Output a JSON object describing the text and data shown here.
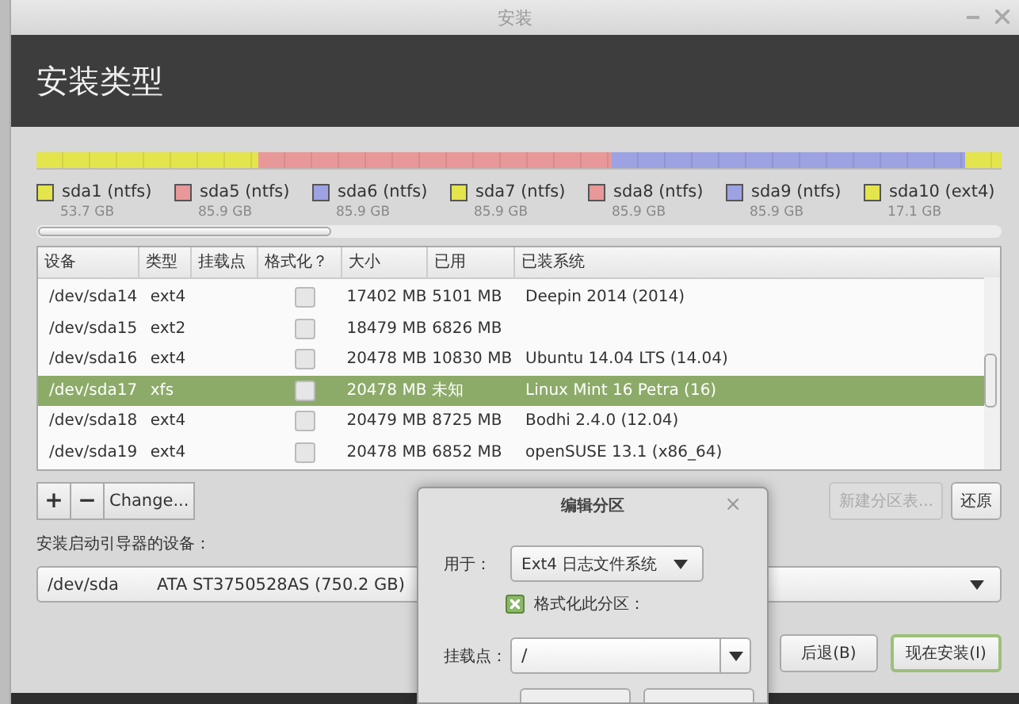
{
  "window": {
    "title": "安装"
  },
  "header": {
    "title": "安装类型"
  },
  "partitions": [
    {
      "name": "sda1 (ntfs)",
      "size": "53.7 GB",
      "color": "#e4e44c"
    },
    {
      "name": "sda5 (ntfs)",
      "size": "85.9 GB",
      "color": "#e89898"
    },
    {
      "name": "sda6 (ntfs)",
      "size": "85.9 GB",
      "color": "#9ca2e2"
    },
    {
      "name": "sda7 (ntfs)",
      "size": "85.9 GB",
      "color": "#e4e44c"
    },
    {
      "name": "sda8 (ntfs)",
      "size": "85.9 GB",
      "color": "#e89898"
    },
    {
      "name": "sda9 (ntfs)",
      "size": "85.9 GB",
      "color": "#9ca2e2"
    },
    {
      "name": "sda10 (ext4)",
      "size": "17.1 GB",
      "color": "#e4e44c"
    }
  ],
  "table": {
    "columns": [
      "设备",
      "类型",
      "挂载点",
      "格式化？",
      "大小",
      "已用",
      "已装系统"
    ],
    "rows": [
      {
        "device": "/dev/sda14",
        "type": "ext4",
        "format": false,
        "size": "17402 MB",
        "used": "5101 MB",
        "system": "Deepin 2014 (2014)",
        "selected": false
      },
      {
        "device": "/dev/sda15",
        "type": "ext2",
        "format": false,
        "size": "18479 MB",
        "used": "6826 MB",
        "system": "",
        "selected": false
      },
      {
        "device": "/dev/sda16",
        "type": "ext4",
        "format": false,
        "size": "20478 MB",
        "used": "10830 MB",
        "system": "Ubuntu 14.04 LTS (14.04)",
        "selected": false
      },
      {
        "device": "/dev/sda17",
        "type": "xfs",
        "format": false,
        "size": "20478 MB",
        "used": "未知",
        "system": "Linux Mint 16 Petra (16)",
        "selected": true
      },
      {
        "device": "/dev/sda18",
        "type": "ext4",
        "format": false,
        "size": "20479 MB",
        "used": "8725 MB",
        "system": "Bodhi 2.4.0 (12.04)",
        "selected": false
      },
      {
        "device": "/dev/sda19",
        "type": "ext4",
        "format": false,
        "size": "20478 MB",
        "used": "6852 MB",
        "system": "openSUSE 13.1 (x86_64)",
        "selected": false
      }
    ]
  },
  "partition_buttons": [
    {
      "label": "+"
    },
    {
      "label": "−"
    },
    {
      "label": "Change..."
    }
  ],
  "table_buttons": [
    {
      "label": "新建分区表...",
      "disabled": true
    },
    {
      "label": "还原",
      "disabled": false
    }
  ],
  "bootloader": {
    "label": "安装启动引导器的设备：",
    "device": "/dev/sda",
    "model": "ATA ST3750528AS (750.2 GB)"
  },
  "actions": [
    {
      "label": "后退(B)",
      "default": false
    },
    {
      "label": "现在安装(I)",
      "default": true
    }
  ],
  "dialog": {
    "title": "编辑分区",
    "close": "×",
    "use_label": "用于：",
    "use_value": "Ext4 日志文件系统",
    "format_label": "格式化此分区：",
    "format_checked": true,
    "mount_label": "挂载点：",
    "mount_value": "/"
  }
}
